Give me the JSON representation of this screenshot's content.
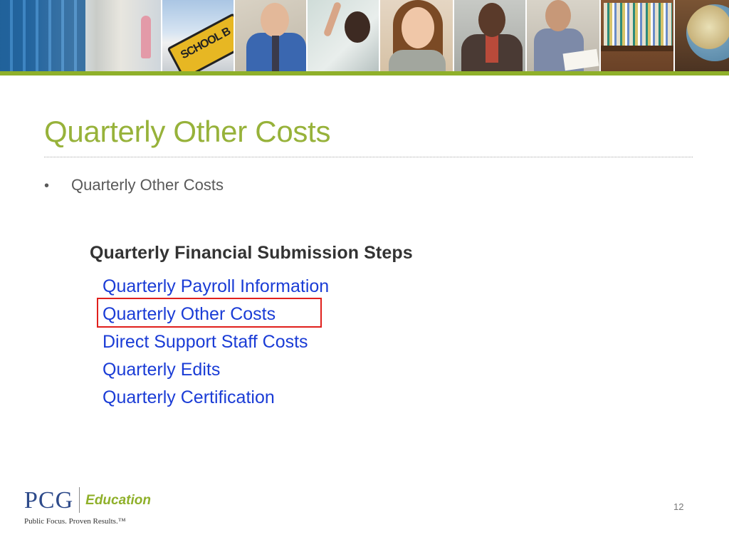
{
  "slide": {
    "title": "Quarterly Other Costs",
    "bullet_symbol": "•",
    "bullet_text": "Quarterly Other Costs",
    "page_number": "12"
  },
  "screenshot": {
    "heading": "Quarterly Financial Submission Steps",
    "steps": [
      {
        "label": "Quarterly Payroll Information"
      },
      {
        "label": "Quarterly Other Costs",
        "highlighted": true
      },
      {
        "label": "Direct Support Staff Costs"
      },
      {
        "label": "Quarterly Edits"
      },
      {
        "label": "Quarterly Certification"
      }
    ],
    "link_color": "#1a3cd6",
    "highlight_color": "#e0201c"
  },
  "banner_photo_text": {
    "bus_sign": "SCHOOL B"
  },
  "logo": {
    "brand": "PCG",
    "division": "Education",
    "tagline": "Public Focus. Proven Results.™"
  },
  "colors": {
    "accent_green": "#8fb02a",
    "title_green": "#97b23a",
    "brand_blue": "#2d4a8a"
  }
}
